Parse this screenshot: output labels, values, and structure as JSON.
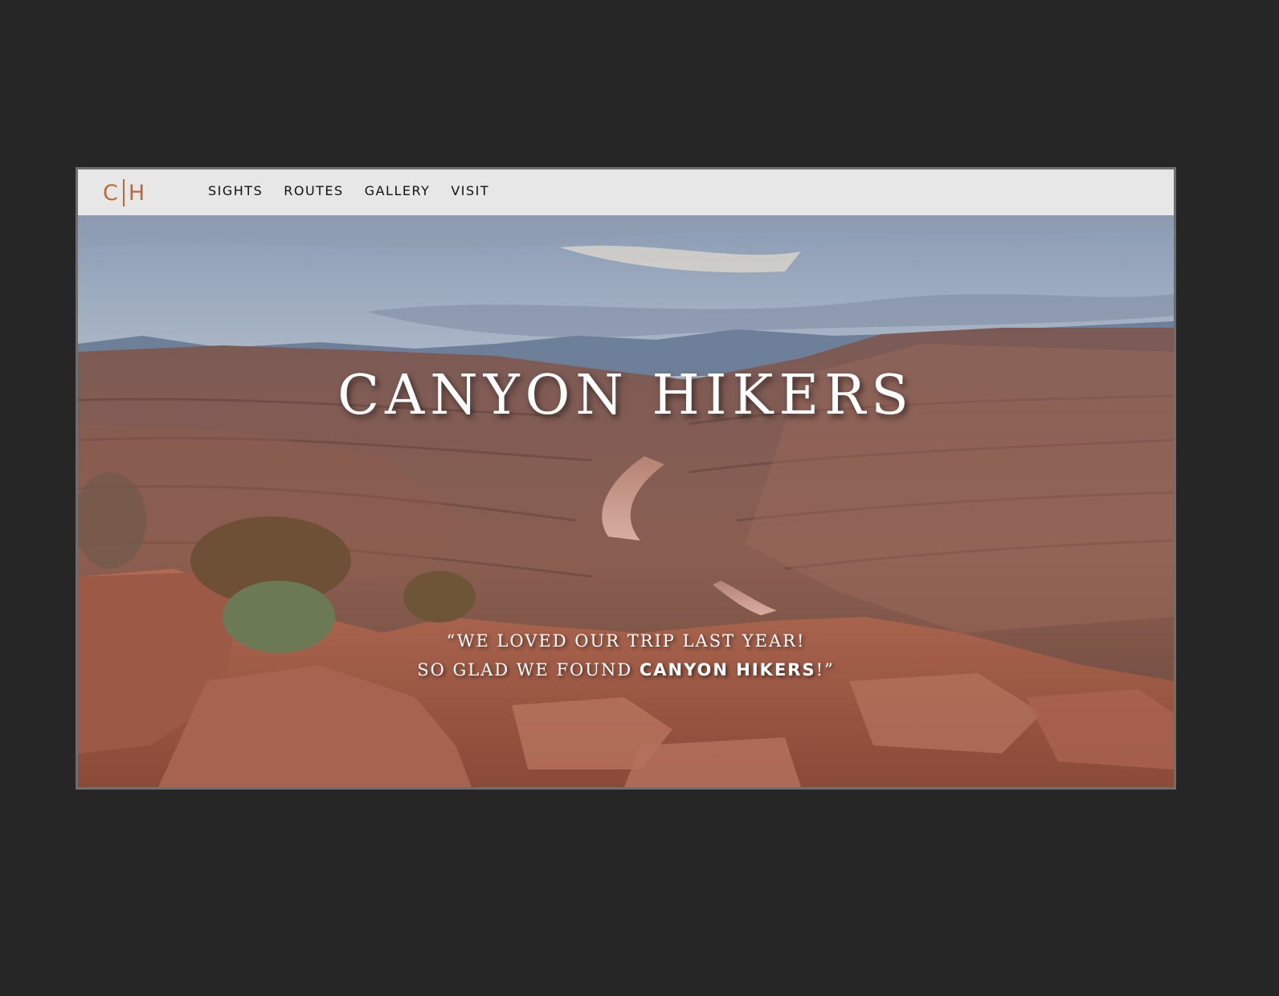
{
  "logo": {
    "left": "C",
    "right": "H"
  },
  "nav": {
    "items": [
      {
        "label": "SIGHTS"
      },
      {
        "label": "ROUTES"
      },
      {
        "label": "GALLERY"
      },
      {
        "label": "VISIT"
      }
    ]
  },
  "hero": {
    "title": "CANYON HIKERS",
    "quote_line1": "“WE LOVED OUR TRIP LAST YEAR!",
    "quote_line2_prefix": "SO GLAD  WE FOUND ",
    "quote_line2_brand": "CANYON HIKERS",
    "quote_line2_suffix": "!”"
  },
  "colors": {
    "brand": "#b86b3a",
    "nav_bg": "#e7e7e7",
    "page_bg": "#262626"
  }
}
